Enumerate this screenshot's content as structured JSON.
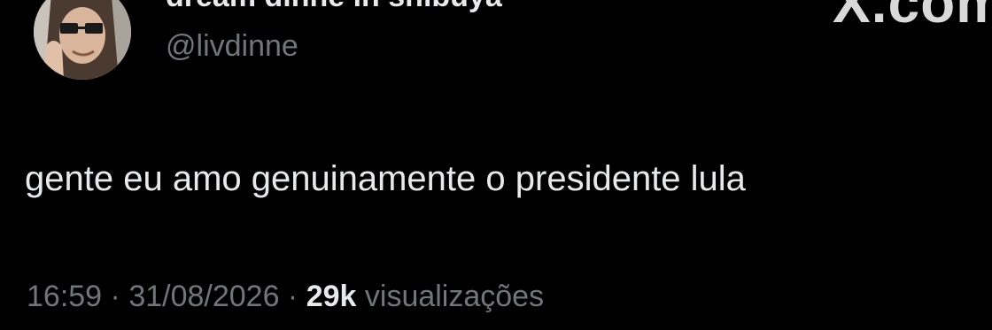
{
  "author": {
    "display_name": "dream dinne in shibuya",
    "handle": "@livdinne"
  },
  "watermark": "X.com",
  "tweet": {
    "text": "gente eu amo genuinamente o presidente lula"
  },
  "meta": {
    "time": "16:59",
    "separator": " · ",
    "date": "31/08/2026",
    "views_count": "29k",
    "views_label": " visualizações"
  },
  "colors": {
    "background": "#000000",
    "primary_text": "#e7e9ea",
    "secondary_text": "#71767b"
  }
}
